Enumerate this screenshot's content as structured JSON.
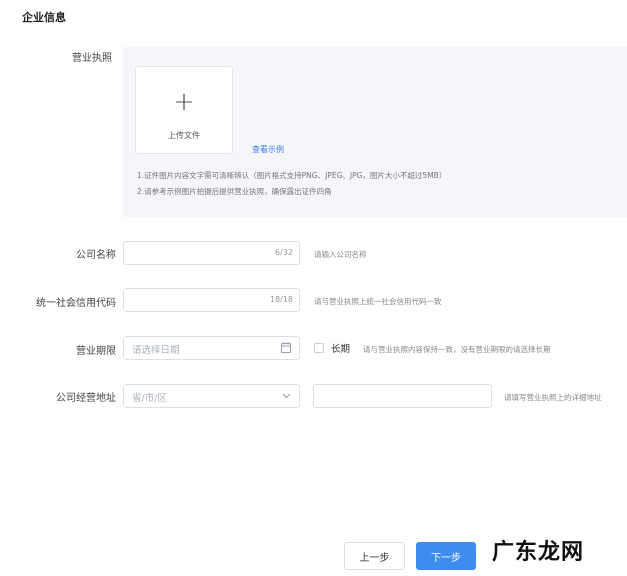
{
  "section_title": "企业信息",
  "license": {
    "label": "营业执照",
    "upload_text": "上传文件",
    "example_link": "查看示例",
    "notes": [
      "1.证件图片内容文字需可清晰辨认（图片格式支持PNG、JPEG、JPG，图片大小不超过5MB）",
      "2.请参考示例图片拍摄后提供营业执照，确保露出证件四角"
    ]
  },
  "company_name": {
    "label": "公司名称",
    "counter": "6/32",
    "hint": "请输入公司名称"
  },
  "credit_code": {
    "label": "统一社会信用代码",
    "counter": "18/18",
    "hint": "请与营业执照上统一社会信用代码一致"
  },
  "business_term": {
    "label": "营业期限",
    "placeholder": "请选择日期",
    "long_term_label": "长期",
    "hint": "请与营业执照内容保持一致，没有营业期限的请选择长期"
  },
  "address": {
    "label": "公司经营地址",
    "region_placeholder": "省/市/区",
    "hint": "请填写营业执照上的详细地址"
  },
  "buttons": {
    "prev": "上一步",
    "next": "下一步"
  },
  "watermark": "广东龙网"
}
